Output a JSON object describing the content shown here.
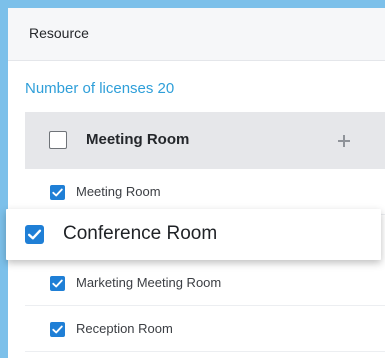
{
  "panel": {
    "title": "Resource",
    "licenses_label": "Number of licenses 20"
  },
  "group": {
    "label": "Meeting Room",
    "checked": false,
    "add_icon": "plus-icon"
  },
  "items": [
    {
      "label": "Meeting Room",
      "checked": true
    },
    {
      "label": "Conference Room",
      "checked": true,
      "highlighted": true
    },
    {
      "label": "Marketing Meeting Room",
      "checked": true
    },
    {
      "label": "Reception Room",
      "checked": true
    }
  ],
  "colors": {
    "accent": "#1f7fd6",
    "link": "#2f9fd9",
    "background": "#7cc0ea",
    "group_bg": "#e6e7ea"
  }
}
